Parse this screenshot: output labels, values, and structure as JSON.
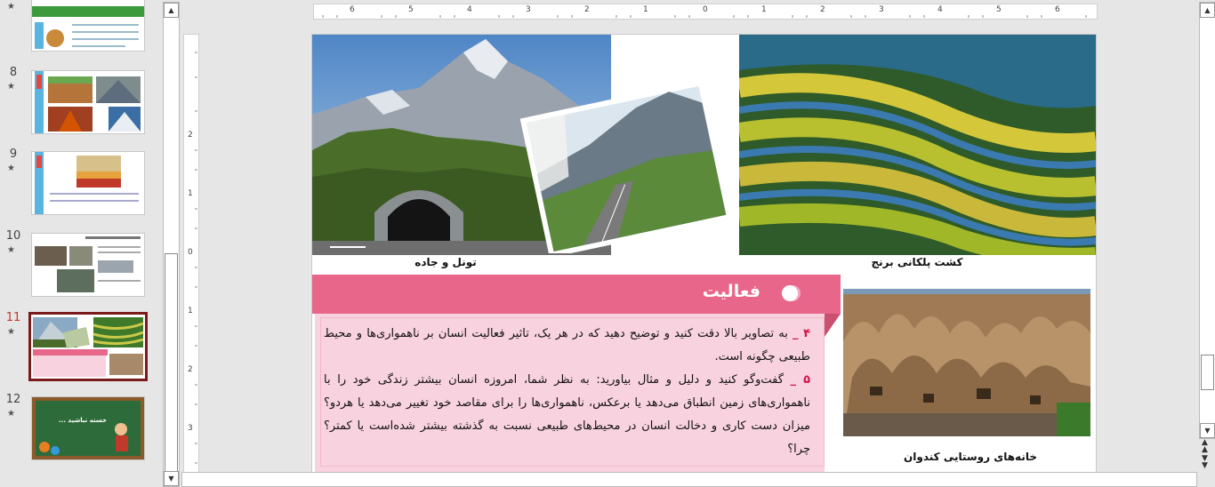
{
  "thumbnails": [
    {
      "num": "8",
      "star": "★"
    },
    {
      "num": "9",
      "star": "★"
    },
    {
      "num": "10",
      "star": "★"
    },
    {
      "num": "11",
      "star": "★"
    },
    {
      "num": "12",
      "star": "★"
    }
  ],
  "top_partial_star": "★",
  "thumb12_text": "خسته نباشید ...",
  "thumb11_banner": "فعالیت",
  "ruler_h": [
    "6",
    "5",
    "4",
    "3",
    "2",
    "1",
    "0",
    "1",
    "2",
    "3",
    "4",
    "5",
    "6"
  ],
  "ruler_v": [
    "2",
    "1",
    "0",
    "1",
    "2",
    "3"
  ],
  "slide": {
    "caption_tunnel": "تونل و جاده",
    "caption_rice": "کشت پلکانی برنج",
    "caption_village": "خانه‌های روستایی کندوان",
    "activity_title": "فعالیت",
    "item4_num": "۴ _",
    "item4_text": " به تصاویر بالا دقت کنید و توضیح دهید که در هر یک، تاثیر فعالیت انسان بر ناهمواری‌ها و محیط طبیعی چگونه است.",
    "item5_num": "۵ _",
    "item5_text": " گفت‌وگو کنید و دلیل و مثال بیاورید: به نظر شما، امروزه انسان بیشتر زندگی خود را با ناهمواری‌های زمین انطباق می‌دهد یا برعکس، ناهمواری‌ها را برای مقاصد خود تغییر می‌دهد یا هردو؟ میزان دست کاری و دخالت انسان در محیط‌های طبیعی نسبت به گذشته بیشتر شده‌است یا کمتر؟ چرا؟"
  },
  "colors": {
    "accent": "#e8668a",
    "textbox": "#f8d2de",
    "selected_border": "#7a1a1a",
    "number_red": "#d1144a"
  }
}
